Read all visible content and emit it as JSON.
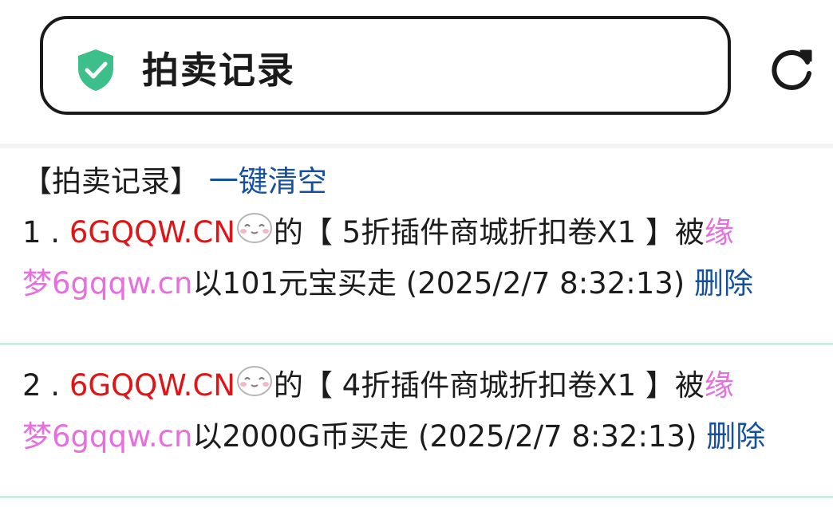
{
  "header": {
    "title": "拍卖记录",
    "security_icon": "shield-check-icon",
    "reload_icon": "reload-icon",
    "shield_color": "#3dbf8a"
  },
  "content": {
    "section_label": "【拍卖记录】",
    "clear_all": "一键清空",
    "records": [
      {
        "index": "1 .",
        "seller": "6GQQW.CN",
        "possessive": "的",
        "item": "【 5折插件商城折扣卷X1 】",
        "by": "被",
        "buyer": "缘梦6gqqw.cn",
        "buyer_part1": "缘",
        "buyer_part2": "梦6gqqw.cn",
        "action": "以101元宝买走 (2025/2/7 8:32:13)",
        "delete": "删除"
      },
      {
        "index": "2 .",
        "seller": "6GQQW.CN",
        "possessive": "的",
        "item": "【 4折插件商城折扣卷X1 】",
        "by": "被",
        "buyer": "缘梦6gqqw.cn",
        "buyer_part1": "缘",
        "buyer_part2": "梦6gqqw.cn",
        "action": "以2000G币买走 (2025/2/7 8:32:13)",
        "delete": "删除"
      }
    ]
  },
  "colors": {
    "seller": "#e01414",
    "buyer": "#e86ee0",
    "link": "#1450a0",
    "separator": "#cfe9e4"
  }
}
